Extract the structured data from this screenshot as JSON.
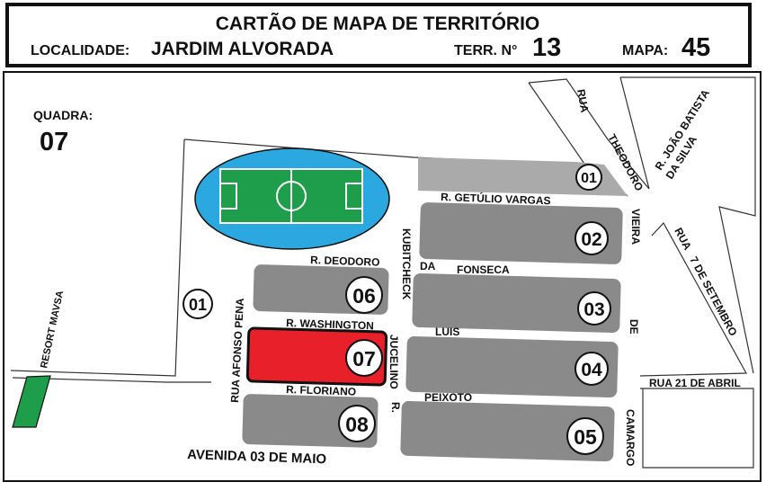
{
  "header": {
    "title": "CARTÃO DE MAPA DE TERRITÓRIO",
    "localidade_label": "LOCALIDADE:",
    "localidade_value": "JARDIM ALVORADA",
    "terr_label": "TERR. N°",
    "terr_value": "13",
    "mapa_label": "MAPA:",
    "mapa_value": "45"
  },
  "quadra": {
    "label": "QUADRA:",
    "value": "07"
  },
  "colors": {
    "block": "#8a8a8a",
    "highlight": "#e8202a",
    "field_green": "#1e9e4a",
    "field_water": "#2aa8df",
    "resort_green": "#1e9e4a"
  },
  "blocks": [
    {
      "id": "01",
      "highlighted": false
    },
    {
      "id": "02",
      "highlighted": false
    },
    {
      "id": "03",
      "highlighted": false
    },
    {
      "id": "04",
      "highlighted": false
    },
    {
      "id": "05",
      "highlighted": false
    },
    {
      "id": "06",
      "highlighted": false
    },
    {
      "id": "07",
      "highlighted": true
    },
    {
      "id": "08",
      "highlighted": false
    },
    {
      "id": "01",
      "highlighted": false
    }
  ],
  "streets": {
    "getulio": "R. GETÚLIO VARGAS",
    "deodoro": "R. DEODORO",
    "washington": "R. WASHINGTON",
    "floriano": "R. FLORIANO",
    "avenida": "AVENIDA 03 DE MAIO",
    "afonso": "RUA AFONSO PENA",
    "kubitcheck": "KUBITCHECK",
    "jucelino": "JUCELINO",
    "r_prefix": "R.",
    "da": "DA",
    "fonseca": "FONSECA",
    "luis": "LUIS",
    "peixoto": "PEIXOTO",
    "rua": "RUA",
    "theodoro": "THEODORO",
    "vieira": "VIEIRA",
    "de": "DE",
    "camargo": "CAMARGO",
    "joao1": "R. JOÃO BATISTA",
    "joao2": "DA SILVA",
    "rua7": "RUA",
    "sete": "7 DE SETEMBRO",
    "rua21": "RUA 21 DE ABRIL",
    "resort": "RESORT MAVSA"
  }
}
